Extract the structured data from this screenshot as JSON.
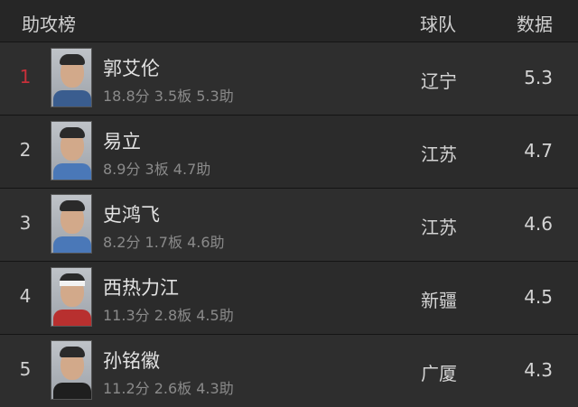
{
  "header": {
    "title": "助攻榜",
    "team_col": "球队",
    "value_col": "数据"
  },
  "rows": [
    {
      "rank": "1",
      "name": "郭艾伦",
      "stats": "18.8分 3.5板 5.3助",
      "team": "辽宁",
      "value": "5.3",
      "rank_color": "#c7303a",
      "shirt_color": "#3a5d8f"
    },
    {
      "rank": "2",
      "name": "易立",
      "stats": "8.9分 3板 4.7助",
      "team": "江苏",
      "value": "4.7",
      "rank_color": "#cfcfcf",
      "shirt_color": "#4a78b8"
    },
    {
      "rank": "3",
      "name": "史鸿飞",
      "stats": "8.2分 1.7板 4.6助",
      "team": "江苏",
      "value": "4.6",
      "rank_color": "#cfcfcf",
      "shirt_color": "#4a78b8"
    },
    {
      "rank": "4",
      "name": "西热力江",
      "stats": "11.3分 2.8板 4.5助",
      "team": "新疆",
      "value": "4.5",
      "rank_color": "#cfcfcf",
      "shirt_color": "#b8302f"
    },
    {
      "rank": "5",
      "name": "孙铭徽",
      "stats": "11.2分 2.6板 4.3助",
      "team": "广厦",
      "value": "4.3",
      "rank_color": "#cfcfcf",
      "shirt_color": "#1f1f1f"
    }
  ]
}
